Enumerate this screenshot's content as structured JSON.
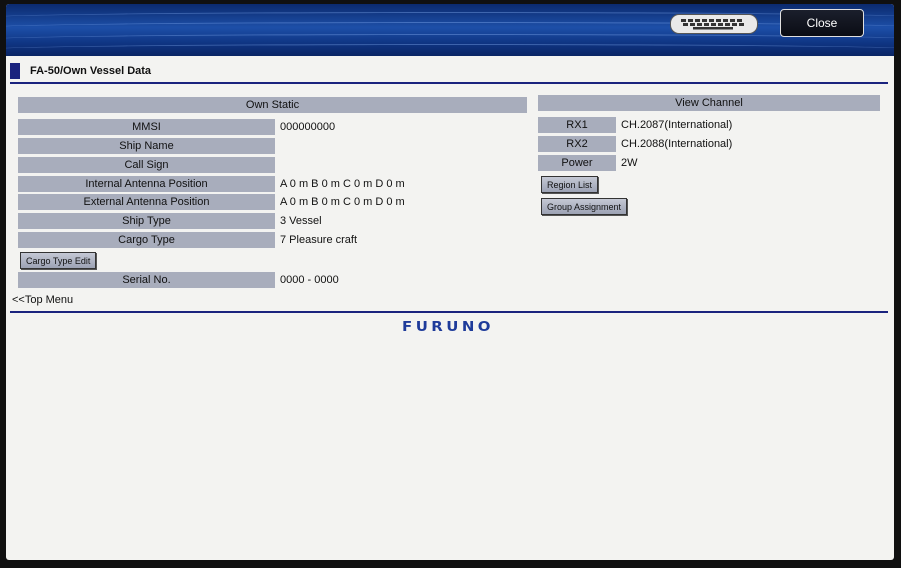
{
  "topbar": {
    "keyboard_icon": "keyboard-icon",
    "close_label": "Close"
  },
  "page": {
    "title": "FA-50/Own Vessel Data"
  },
  "own_static": {
    "header": "Own Static",
    "rows": [
      {
        "label": "MMSI",
        "value": "000000000"
      },
      {
        "label": "Ship Name",
        "value": ""
      },
      {
        "label": "Call Sign",
        "value": ""
      },
      {
        "label": "Internal Antenna Position",
        "value": "A 0 m B 0 m C 0 m D 0 m"
      },
      {
        "label": "External Antenna Position",
        "value": "A 0 m B 0 m C 0 m D 0 m"
      },
      {
        "label": "Ship Type",
        "value": "3 Vessel"
      },
      {
        "label": "Cargo Type",
        "value": "7 Pleasure craft"
      }
    ],
    "cargo_edit_label": "Cargo Type Edit",
    "serial": {
      "label": "Serial No.",
      "value": "0000 - 0000"
    }
  },
  "view_channel": {
    "header": "View Channel",
    "rows": [
      {
        "label": "RX1",
        "value": "CH.2087(International)"
      },
      {
        "label": "RX2",
        "value": "CH.2088(International)"
      },
      {
        "label": "Power",
        "value": "2W"
      }
    ],
    "region_list_label": "Region List",
    "group_assignment_label": "Group Assignment"
  },
  "nav": {
    "top_menu_label": "<<Top Menu"
  },
  "branding": {
    "logo_text": "FURUNO"
  },
  "colors": {
    "accent": "#1a237e",
    "label_bg": "#a8adbc",
    "background": "#f3f3f1"
  }
}
